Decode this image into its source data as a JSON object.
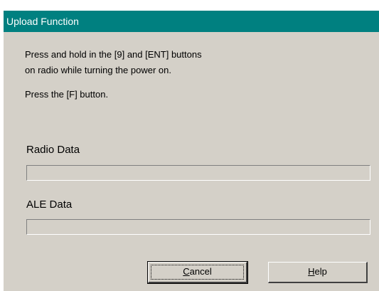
{
  "window": {
    "title": "Upload Function"
  },
  "instructions": {
    "line1": "Press and hold in the [9] and [ENT] buttons",
    "line2": "on radio while turning the power on.",
    "line3": "Press the [F] button."
  },
  "radio_data": {
    "label": "Radio Data",
    "progress": 0
  },
  "ale_data": {
    "label": "ALE Data",
    "progress": 0
  },
  "buttons": {
    "cancel": {
      "mnemonic": "C",
      "rest": "ancel"
    },
    "help": {
      "mnemonic": "H",
      "rest": "elp"
    }
  },
  "colors": {
    "titlebar": "#008080",
    "dialog_bg": "#d4d0c8"
  }
}
